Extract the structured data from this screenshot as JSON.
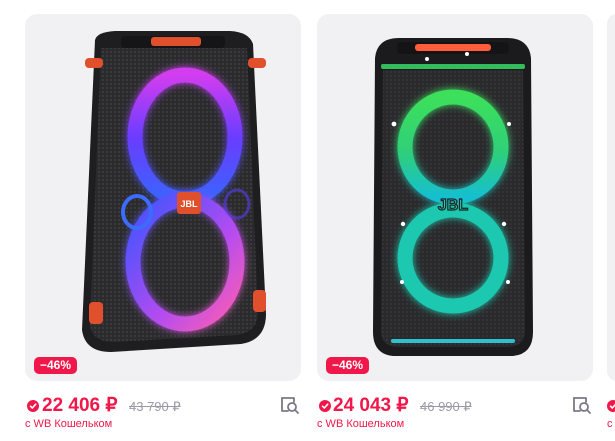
{
  "colors": {
    "accent": "#f0184a",
    "card_bg": "#f1f1f4",
    "old_price": "#9a9aa6"
  },
  "products": [
    {
      "discount": "−46%",
      "price": "22 406 ₽",
      "old_price": "43 790 ₽",
      "wallet_note": "с WB Кошельком",
      "logo": "JBL",
      "icons": [
        "wb-wallet-icon",
        "compare-search-icon"
      ]
    },
    {
      "discount": "−46%",
      "price": "24 043 ₽",
      "old_price": "46 990 ₽",
      "wallet_note": "с WB Кошельком",
      "logo": "JBL",
      "icons": [
        "wb-wallet-icon",
        "compare-search-icon"
      ]
    },
    {
      "wallet_note": "с",
      "icons": [
        "wb-wallet-icon"
      ]
    }
  ]
}
